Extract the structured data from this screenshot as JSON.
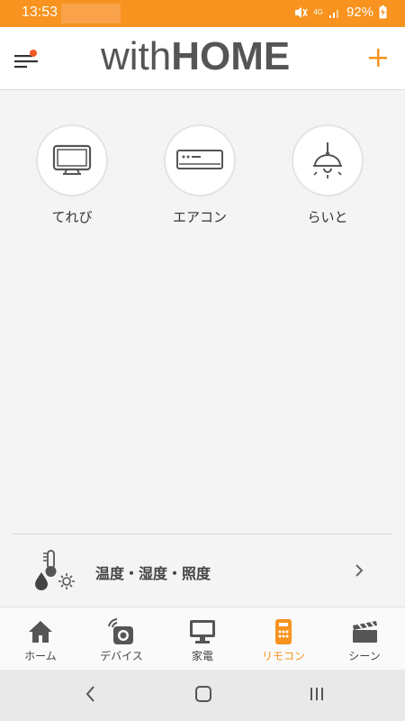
{
  "status_bar": {
    "time": "13:53",
    "battery": "92%",
    "network": "4G"
  },
  "header": {
    "logo_light": "with",
    "logo_bold": "HOME"
  },
  "devices": [
    {
      "label": "てれび",
      "icon": "tv-icon"
    },
    {
      "label": "エアコン",
      "icon": "air-conditioner-icon"
    },
    {
      "label": "らいと",
      "icon": "ceiling-light-icon"
    }
  ],
  "sensor": {
    "label": "温度・湿度・照度",
    "icon": "temperature-humidity-light-icon"
  },
  "tabs": [
    {
      "label": "ホーム",
      "icon": "home-icon"
    },
    {
      "label": "デバイス",
      "icon": "device-icon"
    },
    {
      "label": "家電",
      "icon": "monitor-icon"
    },
    {
      "label": "リモコン",
      "icon": "remote-icon",
      "active": true
    },
    {
      "label": "シーン",
      "icon": "scene-clapper-icon"
    }
  ],
  "colors": {
    "accent": "#f7931e",
    "badge": "#ee5a24",
    "text": "#444444",
    "background": "#f4f4f4"
  }
}
